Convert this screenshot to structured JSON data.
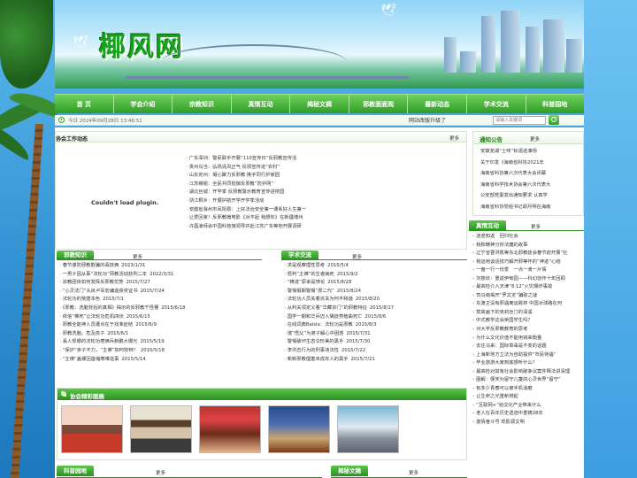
{
  "site": {
    "logo_text": "椰风网"
  },
  "nav": {
    "items": [
      "首 页",
      "学会介绍",
      "宗教知识",
      "真情互动",
      "揭秘文摘",
      "邪教面面观",
      "最新动态",
      "学术交流",
      "科普园地"
    ]
  },
  "statusbar": {
    "date": "今日 2024年09月28日 13:46:51",
    "marquee": "网站改版升级了",
    "search_placeholder": "请输入关键词"
  },
  "work": {
    "title": "协会工作动态",
    "more": "更多",
    "plugin_message": "Couldn't load plugin.",
    "items": [
      "广东深圳：警民联手开展“110宣传日”反邪教宣传活",
      "贵州乌当：弘扬清风正气 反邪宣传进“农村”",
      "山东兖州：凝心聚力反邪教 携手同行护家园",
      "江苏赣榆：全民共同抵御反邪教“防护网”",
      "湖北丝城：开学季 反邪教警示教育宣传进校园",
      "浙江桐乡：开展护航开学开学季活动",
      "安徽省滁州市凤阳县：上好法治安全第一课系好人生第一",
      "让爱回家！反邪教微电影《对不起 我想你》在新疆博州",
      "许昌凌拜会中国科技馆领导并赴江苏广东等地开展调研"
    ]
  },
  "notice": {
    "title": "通知公告",
    "more": "更多",
    "items": [
      "安徽芜湖“土味”标语进濠场",
      "关于印发《海南省科协2021年",
      "海南省科协第六次代表大会闭幕",
      "海南省科学技术协会第六次代表大",
      "公安部党委发出通知要求 认真学",
      "海南省科协党组书记胡月明在海南"
    ]
  },
  "interact": {
    "title": "真情互动",
    "more": "更多",
    "items": [
      "迷途知返　回归社会",
      "我和精神分析法魔的故事",
      "辽宁省曹洪凯等东北邪教徒会春节前开展“社",
      "我运用谈话技巧解开邪等怀的“神迹”心结",
      "一盘一行一份爱　一点一滴一片情",
      "刘慈欣：重返伊甸园——科幻创作十年回顾",
      "最高检介入天津“8·12”火灾爆炸事故",
      "司马南揭开“罗文定”骗取之谜",
      "东渡主没有邪遇离运跨林 中国冰球路在何",
      "梵高画下的克莉丝汀的清溪",
      "中式教学这会英国学生吗？",
      "对大学反邪教教育的思考",
      "为什么文化价值不能用钱来衡量",
      "去往马来：国际草毒是不变的话题",
      "上海新地方立法为自助提供“市民待遇”",
      "毕业旅游大家到底想听什么？",
      "最高检对其有社会影响破争议案件释法讲清理",
      "图解：便宋为留守儿童的心灵世界“留守”",
      "有多少青春可以被手机消磨",
      "让生命之光重新燃起",
      "“互联网+”给文化产业带来什么",
      "老人在百年历史遗迹中重铸28年",
      "激情奋斗号 现影源文明"
    ]
  },
  "knowledge": {
    "title": "邪教知识",
    "more": "更多",
    "items": [
      {
        "text": "春节谨防邪教欺骗的毒技俩",
        "date": "2023/1/31"
      },
      {
        "text": "一男子因从事“法轮功”邪教活动获刑二年",
        "date": "2022/3/31"
      },
      {
        "text": "宗教团体如何发挥反邪教优势",
        "date": "2015/7/27"
      },
      {
        "text": "“心灵法门”头目卢军宏编造获奖证书",
        "date": "2015/7/24"
      },
      {
        "text": "法轮功的荒唐本色",
        "date": "2015/7/1"
      },
      {
        "text": "《邪教：洗脑背后的真相》揭示的反邪教千怪梗",
        "date": "2015/6/18"
      },
      {
        "text": "依信“佛死”让法轮功危机四伏",
        "date": "2015/6/15"
      },
      {
        "text": "邪教全能神人员遭点在于找准症结",
        "date": "2015/6/9"
      },
      {
        "text": "邪教洗脑，危及孩子",
        "date": "2015/6/1"
      },
      {
        "text": "丢人现眼的法轮功痞俩兵新鹏大爆光",
        "date": "2015/5/19"
      },
      {
        "text": "“保护”亲子不力，“主佛”如何狡辩？",
        "date": "2015/5/18"
      },
      {
        "text": "“主佛”盖挪回首缩寒难逃事",
        "date": "2015/5/14"
      }
    ]
  },
  "academic": {
    "title": "学术交流",
    "more": "更多",
    "items": [
      {
        "text": "求是观察理性思考",
        "date": "2015/5/4"
      },
      {
        "text": "怒判“主佛”的生者病死",
        "date": "2015/9/2"
      },
      {
        "text": "“精进”原来是悖论",
        "date": "2015/8/28"
      },
      {
        "text": "警惕假期警惕“邪二代”",
        "date": "2015/8/24"
      },
      {
        "text": "法轮功人员关着派关为何不和谐",
        "date": "2015/8/20"
      },
      {
        "text": "从利关领定义看“华藏宗门”的邪教特征",
        "date": "2015/8/17"
      },
      {
        "text": "国学一期和华兵迈入偶徒势植曲死亡",
        "date": "2015/8/6"
      },
      {
        "text": "在线词典Balsla：法轮功是邪教",
        "date": "2015/8/3"
      },
      {
        "text": "谎“悟父”为弟子解心中困惑",
        "date": "2015/7/31"
      },
      {
        "text": "警惕破坏生态伞形美的黑手",
        "date": "2015/7/30"
      },
      {
        "text": "李洪志行为的刑事违法性",
        "date": "2015/7/22"
      },
      {
        "text": "新新邪教僵害未成年人的黑手",
        "date": "2015/7/21"
      }
    ]
  },
  "gallery": {
    "title": "协会精彩图展"
  },
  "garden": {
    "title": "科普园地",
    "more": "更多"
  },
  "fanjiao": {
    "title": "揭秘文摘",
    "more": "更多"
  },
  "colors": {
    "brand_green": "#2a9120",
    "nav_green": "#3fae30",
    "accent_red": "#cc0000"
  }
}
